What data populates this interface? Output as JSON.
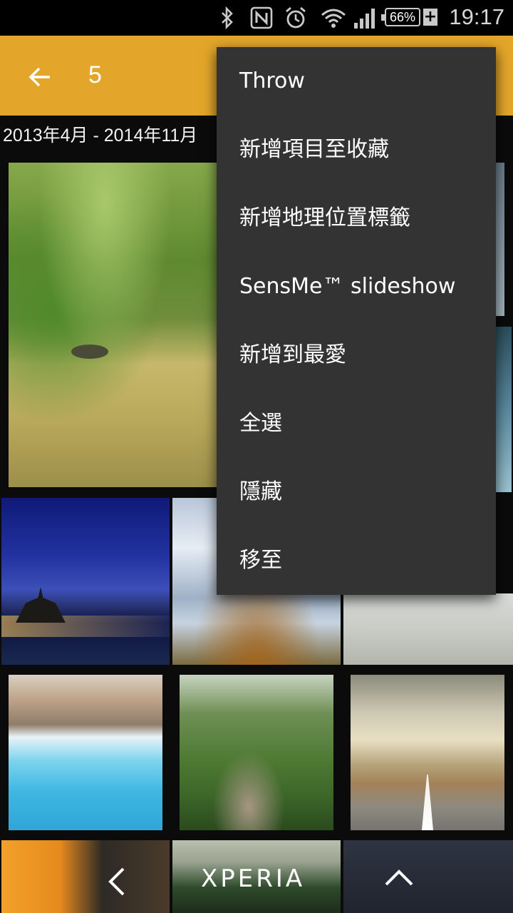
{
  "status_bar": {
    "icons": [
      "bluetooth-icon",
      "nfc-icon",
      "alarm-icon",
      "wifi-icon",
      "signal-icon"
    ],
    "battery": "66%",
    "time": "19:17"
  },
  "action_bar": {
    "back_icon": "arrow-left-icon",
    "selected_count": "5",
    "accent": "#e3a62a"
  },
  "gallery": {
    "date_range": "2013年4月 - 2014年11月"
  },
  "overflow_menu": {
    "items": [
      "Throw",
      "新增項目至收藏",
      "新增地理位置標籤",
      "SensMe™ slideshow",
      "新增到最愛",
      "全選",
      "隱藏",
      "移至"
    ]
  },
  "bottom_nav": {
    "back_icon": "chevron-left-icon",
    "brand": "XPERIA",
    "up_icon": "chevron-up-icon"
  }
}
